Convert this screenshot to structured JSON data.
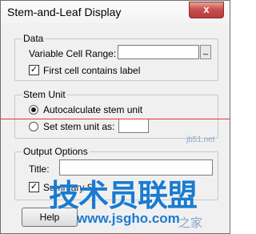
{
  "dialog": {
    "title": "Stem-and-Leaf Display",
    "close_glyph": "x"
  },
  "data_group": {
    "legend": "Data",
    "variable_cell_range_label": "Variable Cell Range:",
    "variable_cell_range_value": "",
    "range_button_glyph": "_",
    "first_cell_label": "First cell contains label",
    "first_cell_checked": true
  },
  "stem_unit_group": {
    "legend": "Stem Unit",
    "autocalc_label": "Autocalculate stem unit",
    "autocalc_selected": true,
    "set_stem_label": "Set stem unit as:",
    "set_stem_selected": false,
    "set_stem_value": ""
  },
  "output_group": {
    "legend": "Output Options",
    "title_label": "Title:",
    "title_value": "",
    "summary_label": "Summary Statistics",
    "summary_partial_visible": "Summary St",
    "summary_checked": true
  },
  "buttons": {
    "help_label": "Help",
    "help_visible": "Help"
  },
  "watermark": {
    "main": "技术员联盟",
    "url": "www.jsgho.com",
    "side_top": "jb51.net",
    "side_bottom": "之家"
  },
  "check_glyph": "✓",
  "colors": {
    "accent_watermark": "#1a7bd0",
    "close_button": "#c75050",
    "red_line": "#e0332f"
  }
}
